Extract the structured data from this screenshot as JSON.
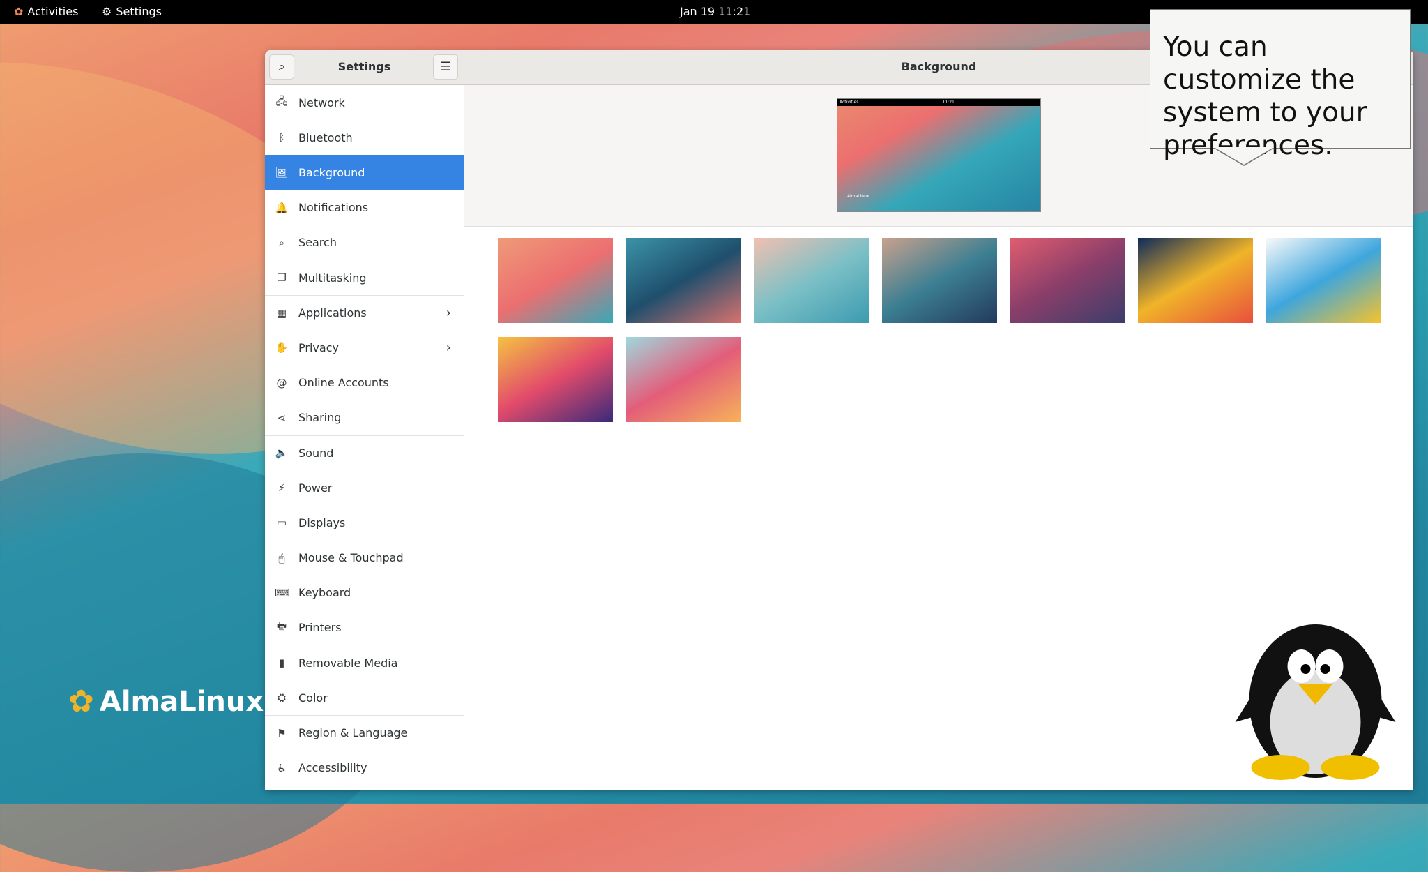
{
  "topbar": {
    "activities": "Activities",
    "app": "Settings",
    "clock": "Jan 19  11:21"
  },
  "sidebar": {
    "title": "Settings",
    "items": [
      {
        "label": "Network",
        "icon": "network-icon",
        "glyph": "🖧"
      },
      {
        "label": "Bluetooth",
        "icon": "bluetooth-icon",
        "glyph": "ᛒ"
      },
      {
        "label": "Background",
        "icon": "image-icon",
        "glyph": "🖼",
        "selected": true
      },
      {
        "label": "Notifications",
        "icon": "bell-icon",
        "glyph": "🔔"
      },
      {
        "label": "Search",
        "icon": "search-icon",
        "glyph": "⌕"
      },
      {
        "label": "Multitasking",
        "icon": "multitasking-icon",
        "glyph": "❐"
      },
      {
        "label": "Applications",
        "icon": "grid-icon",
        "glyph": "▦",
        "chevron": true
      },
      {
        "label": "Privacy",
        "icon": "hand-icon",
        "glyph": "✋",
        "chevron": true
      },
      {
        "label": "Online Accounts",
        "icon": "at-icon",
        "glyph": "@"
      },
      {
        "label": "Sharing",
        "icon": "share-icon",
        "glyph": "⋖"
      },
      {
        "label": "Sound",
        "icon": "speaker-icon",
        "glyph": "🔈"
      },
      {
        "label": "Power",
        "icon": "power-icon",
        "glyph": "⚡"
      },
      {
        "label": "Displays",
        "icon": "display-icon",
        "glyph": "▭"
      },
      {
        "label": "Mouse & Touchpad",
        "icon": "mouse-icon",
        "glyph": "🖱"
      },
      {
        "label": "Keyboard",
        "icon": "keyboard-icon",
        "glyph": "⌨"
      },
      {
        "label": "Printers",
        "icon": "printer-icon",
        "glyph": "🖶"
      },
      {
        "label": "Removable Media",
        "icon": "media-icon",
        "glyph": "▮"
      },
      {
        "label": "Color",
        "icon": "color-icon",
        "glyph": "⛭"
      },
      {
        "label": "Region & Language",
        "icon": "flag-icon",
        "glyph": "⚑"
      },
      {
        "label": "Accessibility",
        "icon": "accessibility-icon",
        "glyph": "♿"
      }
    ]
  },
  "main": {
    "title": "Background",
    "preview_bar": {
      "left": "Activities",
      "center": "11:21"
    },
    "preview_brand": "AlmaLinux"
  },
  "wallpapers": [
    {
      "name": "wallpaper-1",
      "colors": [
        "#ef9a78",
        "#ec6f70",
        "#38a8b8"
      ]
    },
    {
      "name": "wallpaper-2",
      "colors": [
        "#3b93a7",
        "#1f4f6d",
        "#d9726e"
      ]
    },
    {
      "name": "wallpaper-3",
      "colors": [
        "#f2c0b0",
        "#7cc0c6",
        "#3c9bb0"
      ]
    },
    {
      "name": "wallpaper-4",
      "colors": [
        "#c9a18e",
        "#3c7f92",
        "#233a5c"
      ]
    },
    {
      "name": "wallpaper-5",
      "colors": [
        "#e05d6f",
        "#8a3e6a",
        "#3c3d6b"
      ]
    },
    {
      "name": "wallpaper-6",
      "colors": [
        "#0f2a5a",
        "#f0b429",
        "#e84f3d"
      ]
    },
    {
      "name": "wallpaper-7",
      "colors": [
        "#fafafa",
        "#3ea6dd",
        "#f5c32c"
      ]
    },
    {
      "name": "wallpaper-8",
      "colors": [
        "#f5c242",
        "#e24b6b",
        "#3a2a7a"
      ]
    },
    {
      "name": "wallpaper-9",
      "colors": [
        "#9fd8de",
        "#e35d7a",
        "#f7b259"
      ]
    }
  ],
  "tooltip": {
    "text": "You can customize the system to your preferences."
  },
  "logo": {
    "text": "AlmaLinux"
  }
}
